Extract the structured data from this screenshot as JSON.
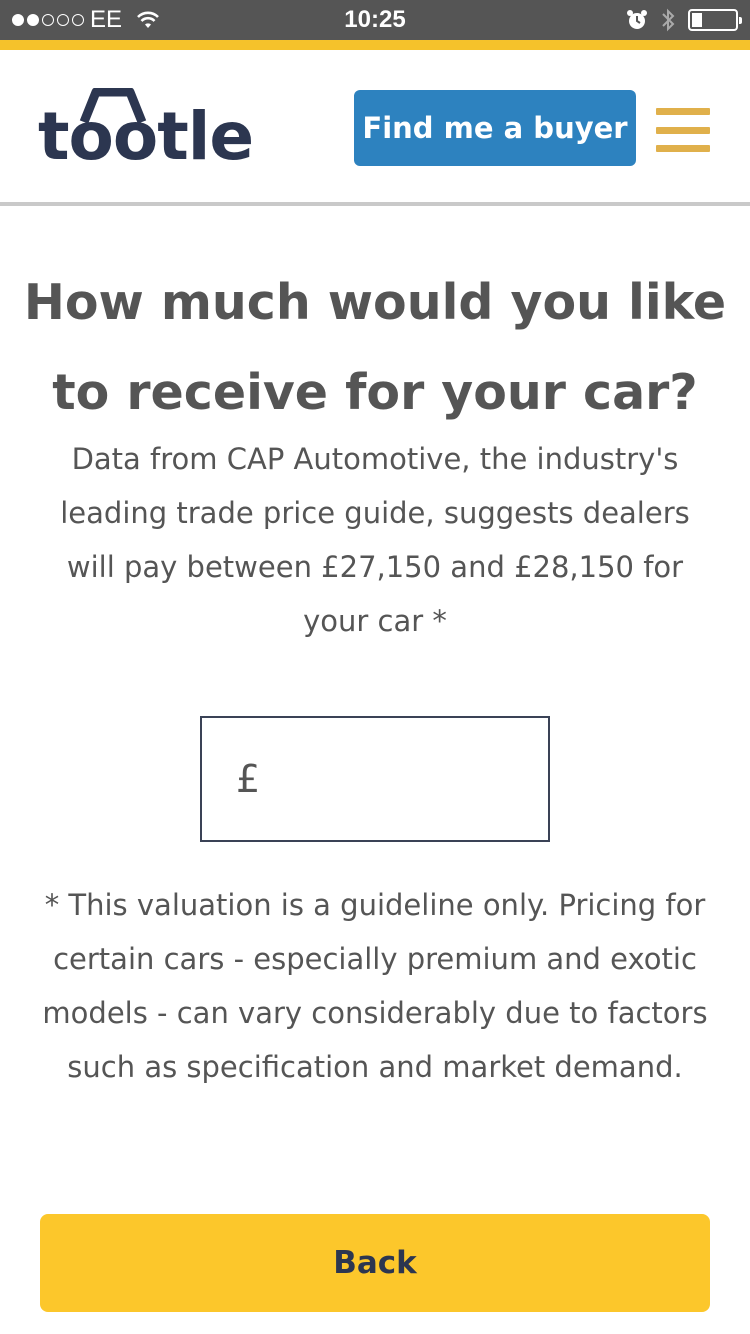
{
  "status_bar": {
    "carrier": "EE",
    "time": "10:25",
    "signal_bars_filled": 2,
    "signal_bars_total": 5
  },
  "header": {
    "logo_text": "tootle",
    "find_buyer_label": "Find me a buyer",
    "menu_icon": "hamburger-menu-icon"
  },
  "main": {
    "title": "How much would you like to receive for your car?",
    "subtitle": "Data from CAP Automotive, the industry's leading trade price guide, suggests dealers will pay between £27,150 and £28,150 for your car *",
    "price_input": {
      "currency_symbol": "£",
      "value": "",
      "placeholder": ""
    },
    "disclaimer": "* This valuation is a guideline only. Pricing for certain cars - especially premium and exotic models - can vary considerably due to factors such as specification and market demand.",
    "back_label": "Back"
  },
  "colors": {
    "brand_navy": "#2c3650",
    "primary_blue": "#2d82bf",
    "accent_yellow": "#fcc72b",
    "menu_gold": "#e0b04b",
    "text_gray": "#555555"
  }
}
